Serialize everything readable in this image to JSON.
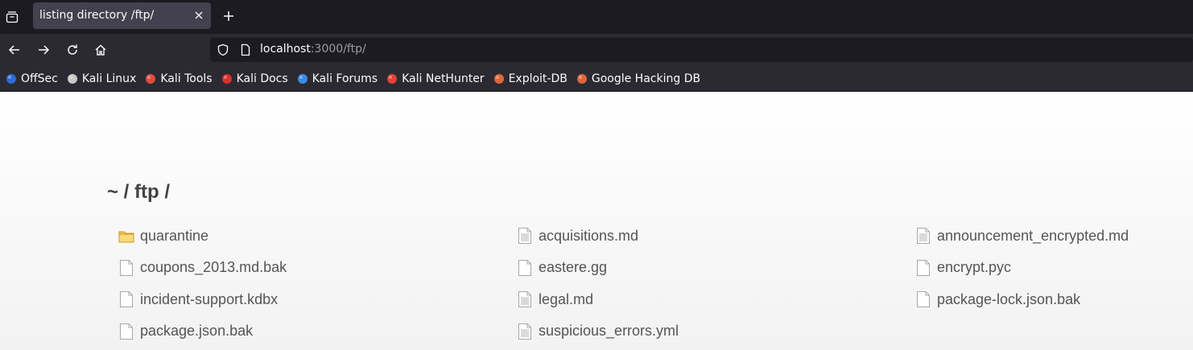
{
  "tab": {
    "title": "listing directory /ftp/"
  },
  "urlbar": {
    "host": "localhost",
    "rest": ":3000/ftp/"
  },
  "bookmarks": [
    {
      "label": "OffSec",
      "icon": "offsec-icon",
      "color": "#2e6bd6"
    },
    {
      "label": "Kali Linux",
      "icon": "kali-dragon-icon",
      "color": "#c8c8c8"
    },
    {
      "label": "Kali Tools",
      "icon": "kali-tools-icon",
      "color": "#e04b3c"
    },
    {
      "label": "Kali Docs",
      "icon": "kali-docs-icon",
      "color": "#d9302c"
    },
    {
      "label": "Kali Forums",
      "icon": "kali-forums-icon",
      "color": "#3a8de0"
    },
    {
      "label": "Kali NetHunter",
      "icon": "kali-nethunter-icon",
      "color": "#e0433a"
    },
    {
      "label": "Exploit-DB",
      "icon": "exploit-db-icon",
      "color": "#e0663a"
    },
    {
      "label": "Google Hacking DB",
      "icon": "ghdb-icon",
      "color": "#e0663a"
    }
  ],
  "page": {
    "breadcrumb": "~ / ftp /",
    "files": [
      {
        "name": "quarantine",
        "type": "folder"
      },
      {
        "name": "acquisitions.md",
        "type": "text"
      },
      {
        "name": "announcement_encrypted.md",
        "type": "text"
      },
      {
        "name": "coupons_2013.md.bak",
        "type": "blank"
      },
      {
        "name": "eastere.gg",
        "type": "blank"
      },
      {
        "name": "encrypt.pyc",
        "type": "blank"
      },
      {
        "name": "incident-support.kdbx",
        "type": "blank"
      },
      {
        "name": "legal.md",
        "type": "text"
      },
      {
        "name": "package-lock.json.bak",
        "type": "blank"
      },
      {
        "name": "package.json.bak",
        "type": "blank"
      },
      {
        "name": "suspicious_errors.yml",
        "type": "text"
      }
    ]
  }
}
